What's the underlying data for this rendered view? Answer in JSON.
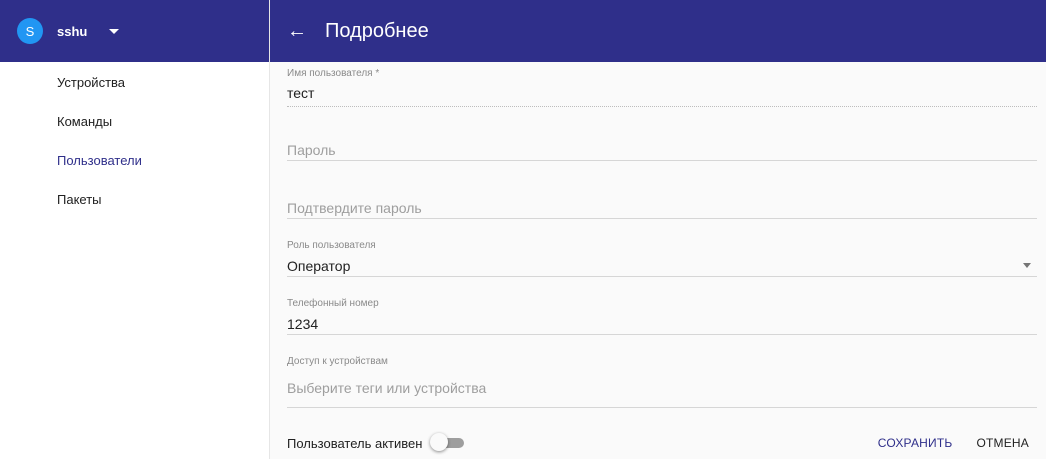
{
  "user": {
    "avatar_letter": "S",
    "name": "sshu"
  },
  "nav": {
    "items": [
      {
        "label": "Устройства"
      },
      {
        "label": "Команды"
      },
      {
        "label": "Пользователи",
        "active": true
      },
      {
        "label": "Пакеты"
      }
    ]
  },
  "header": {
    "title": "Подробнее"
  },
  "form": {
    "username": {
      "label": "Имя пользователя *",
      "value": "тест"
    },
    "password": {
      "placeholder": "Пароль"
    },
    "confirm_password": {
      "placeholder": "Подтвердите пароль"
    },
    "role": {
      "label": "Роль пользователя",
      "value": "Оператор"
    },
    "phone": {
      "label": "Телефонный номер",
      "value": "1234"
    },
    "device_access": {
      "label": "Доступ к устройствам",
      "placeholder": "Выберите теги или устройства"
    },
    "active": {
      "label": "Пользователь активен",
      "value": false
    }
  },
  "actions": {
    "save": "СОХРАНИТЬ",
    "cancel": "ОТМЕНА"
  },
  "colors": {
    "primary": "#2f2f8a",
    "avatar": "#2196f3"
  }
}
